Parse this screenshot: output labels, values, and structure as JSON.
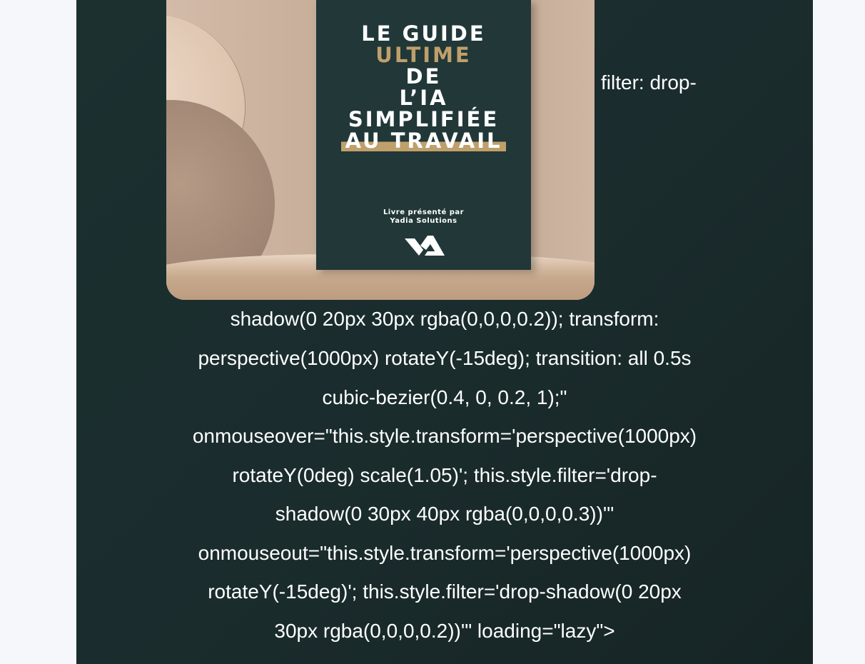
{
  "cover": {
    "line1": "LE GUIDE",
    "line2": "ULTIME",
    "line3": "DE",
    "line4": "L’IA",
    "line5": "SIMPLIFIÉE",
    "line6": "AU TRAVAIL",
    "presented_line1": "Livre présenté par",
    "presented_line2": "Yadia Solutions",
    "logo_icon": "ya-logo-icon"
  },
  "code_text": {
    "line0": "filter: drop-",
    "line1": "shadow(0 20px 30px rgba(0,0,0,0.2)); transform:",
    "line2": "perspective(1000px) rotateY(-15deg); transition: all 0.5s",
    "line3": "cubic-bezier(0.4, 0, 0.2, 1);\"",
    "line4": "onmouseover=\"this.style.transform='perspective(1000px)",
    "line5": "rotateY(0deg) scale(1.05)'; this.style.filter='drop-",
    "line6": "shadow(0 30px 40px rgba(0,0,0,0.3))'\"",
    "line7": "onmouseout=\"this.style.transform='perspective(1000px)",
    "line8": "rotateY(-15deg)'; this.style.filter='drop-shadow(0 20px",
    "line9": "30px rgba(0,0,0,0.2))'\" loading=\"lazy\">"
  },
  "colors": {
    "panel": "#1b2e2e",
    "cover": "#213738",
    "gold": "#bfa06a"
  }
}
